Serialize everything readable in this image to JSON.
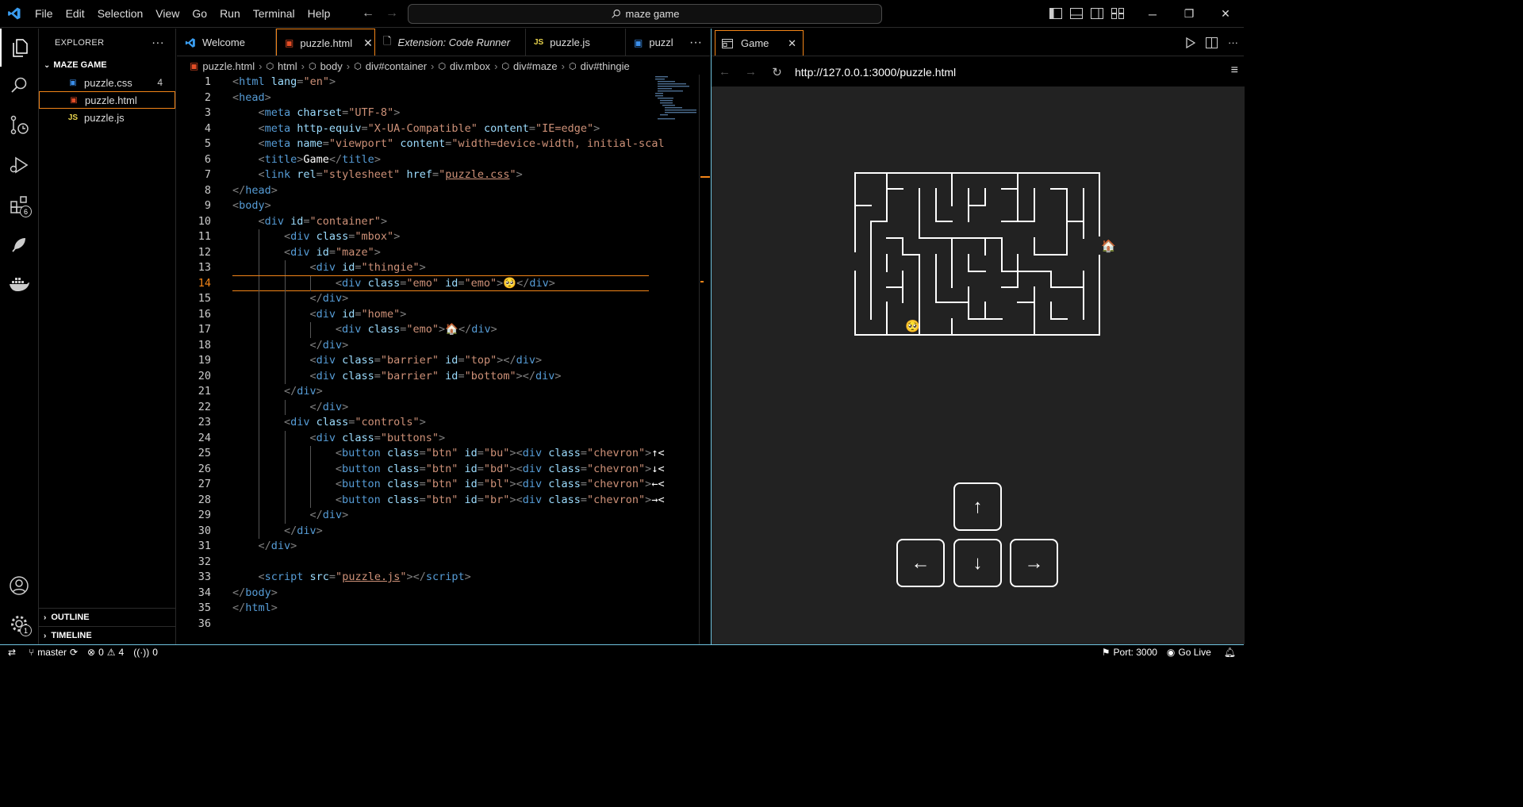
{
  "titlebar": {
    "menu": [
      "File",
      "Edit",
      "Selection",
      "View",
      "Go",
      "Run",
      "Terminal",
      "Help"
    ],
    "search": "maze game"
  },
  "sidebar": {
    "title": "EXPLORER",
    "folder": "MAZE GAME",
    "files": [
      {
        "name": "puzzle.css",
        "icon": "css-file-icon",
        "count": "4"
      },
      {
        "name": "puzzle.html",
        "icon": "html-file-icon",
        "count": ""
      },
      {
        "name": "puzzle.js",
        "icon": "js-file-icon",
        "count": ""
      }
    ],
    "outline": "OUTLINE",
    "timeline": "TIMELINE"
  },
  "activity_badges": {
    "extensions": "6",
    "settings": "1"
  },
  "tabs": [
    {
      "label": "Welcome"
    },
    {
      "label": "puzzle.html"
    },
    {
      "label": "Extension: Code Runner"
    },
    {
      "label": "puzzle.js"
    },
    {
      "label": "puzzl"
    }
  ],
  "breadcrumb": [
    "puzzle.html",
    "html",
    "body",
    "div#container",
    "div.mbox",
    "div#maze",
    "div#thingie"
  ],
  "editor_lines": [
    {
      "indent": 0,
      "tokens": [
        [
          "p",
          "<"
        ],
        [
          "t",
          "html"
        ],
        [
          "a",
          " lang"
        ],
        [
          "p",
          "="
        ],
        [
          "s",
          "\"en\""
        ],
        [
          "p",
          ">"
        ]
      ]
    },
    {
      "indent": 0,
      "tokens": [
        [
          "p",
          "<"
        ],
        [
          "t",
          "head"
        ],
        [
          "p",
          ">"
        ]
      ]
    },
    {
      "indent": 1,
      "tokens": [
        [
          "p",
          "<"
        ],
        [
          "t",
          "meta"
        ],
        [
          "a",
          " charset"
        ],
        [
          "p",
          "="
        ],
        [
          "s",
          "\"UTF-8\""
        ],
        [
          "p",
          ">"
        ]
      ]
    },
    {
      "indent": 1,
      "tokens": [
        [
          "p",
          "<"
        ],
        [
          "t",
          "meta"
        ],
        [
          "a",
          " http-equiv"
        ],
        [
          "p",
          "="
        ],
        [
          "s",
          "\"X-UA-Compatible\""
        ],
        [
          "a",
          " content"
        ],
        [
          "p",
          "="
        ],
        [
          "s",
          "\"IE=edge\""
        ],
        [
          "p",
          ">"
        ]
      ]
    },
    {
      "indent": 1,
      "tokens": [
        [
          "p",
          "<"
        ],
        [
          "t",
          "meta"
        ],
        [
          "a",
          " name"
        ],
        [
          "p",
          "="
        ],
        [
          "s",
          "\"viewport\""
        ],
        [
          "a",
          " content"
        ],
        [
          "p",
          "="
        ],
        [
          "s",
          "\"width=device-width, initial-scal"
        ]
      ]
    },
    {
      "indent": 1,
      "tokens": [
        [
          "p",
          "<"
        ],
        [
          "t",
          "title"
        ],
        [
          "p",
          ">"
        ],
        [
          "tx",
          "Game"
        ],
        [
          "p",
          "</"
        ],
        [
          "t",
          "title"
        ],
        [
          "p",
          ">"
        ]
      ]
    },
    {
      "indent": 1,
      "tokens": [
        [
          "p",
          "<"
        ],
        [
          "t",
          "link"
        ],
        [
          "a",
          " rel"
        ],
        [
          "p",
          "="
        ],
        [
          "s",
          "\"stylesheet\""
        ],
        [
          "a",
          " href"
        ],
        [
          "p",
          "="
        ],
        [
          "s",
          "\""
        ],
        [
          "su",
          "puzzle.css"
        ],
        [
          "s",
          "\""
        ],
        [
          "p",
          ">"
        ]
      ]
    },
    {
      "indent": 0,
      "tokens": [
        [
          "p",
          "</"
        ],
        [
          "t",
          "head"
        ],
        [
          "p",
          ">"
        ]
      ]
    },
    {
      "indent": 0,
      "tokens": [
        [
          "p",
          "<"
        ],
        [
          "t",
          "body"
        ],
        [
          "p",
          ">"
        ]
      ]
    },
    {
      "indent": 1,
      "tokens": [
        [
          "p",
          "<"
        ],
        [
          "t",
          "div"
        ],
        [
          "a",
          " id"
        ],
        [
          "p",
          "="
        ],
        [
          "s",
          "\"container\""
        ],
        [
          "p",
          ">"
        ]
      ]
    },
    {
      "indent": 2,
      "tokens": [
        [
          "p",
          "<"
        ],
        [
          "t",
          "div"
        ],
        [
          "a",
          " class"
        ],
        [
          "p",
          "="
        ],
        [
          "s",
          "\"mbox\""
        ],
        [
          "p",
          ">"
        ]
      ]
    },
    {
      "indent": 2,
      "tokens": [
        [
          "p",
          "<"
        ],
        [
          "t",
          "div"
        ],
        [
          "a",
          " id"
        ],
        [
          "p",
          "="
        ],
        [
          "s",
          "\"maze\""
        ],
        [
          "p",
          ">"
        ]
      ]
    },
    {
      "indent": 3,
      "tokens": [
        [
          "p",
          "<"
        ],
        [
          "t",
          "div"
        ],
        [
          "a",
          " id"
        ],
        [
          "p",
          "="
        ],
        [
          "s",
          "\"thingie\""
        ],
        [
          "p",
          ">"
        ]
      ]
    },
    {
      "indent": 4,
      "tokens": [
        [
          "p",
          "<"
        ],
        [
          "t",
          "div"
        ],
        [
          "a",
          " class"
        ],
        [
          "p",
          "="
        ],
        [
          "s",
          "\"emo\""
        ],
        [
          "a",
          " id"
        ],
        [
          "p",
          "="
        ],
        [
          "s",
          "\"emo\""
        ],
        [
          "p",
          ">"
        ],
        [
          "tx",
          "🥺"
        ],
        [
          "p",
          "</"
        ],
        [
          "t",
          "div"
        ],
        [
          "p",
          ">"
        ]
      ]
    },
    {
      "indent": 3,
      "tokens": [
        [
          "p",
          "</"
        ],
        [
          "t",
          "div"
        ],
        [
          "p",
          ">"
        ]
      ]
    },
    {
      "indent": 3,
      "tokens": [
        [
          "p",
          "<"
        ],
        [
          "t",
          "div"
        ],
        [
          "a",
          " id"
        ],
        [
          "p",
          "="
        ],
        [
          "s",
          "\"home\""
        ],
        [
          "p",
          ">"
        ]
      ]
    },
    {
      "indent": 4,
      "tokens": [
        [
          "p",
          "<"
        ],
        [
          "t",
          "div"
        ],
        [
          "a",
          " class"
        ],
        [
          "p",
          "="
        ],
        [
          "s",
          "\"emo\""
        ],
        [
          "p",
          ">"
        ],
        [
          "tx",
          "🏠"
        ],
        [
          "p",
          "</"
        ],
        [
          "t",
          "div"
        ],
        [
          "p",
          ">"
        ]
      ]
    },
    {
      "indent": 3,
      "tokens": [
        [
          "p",
          "</"
        ],
        [
          "t",
          "div"
        ],
        [
          "p",
          ">"
        ]
      ]
    },
    {
      "indent": 3,
      "tokens": [
        [
          "p",
          "<"
        ],
        [
          "t",
          "div"
        ],
        [
          "a",
          " class"
        ],
        [
          "p",
          "="
        ],
        [
          "s",
          "\"barrier\""
        ],
        [
          "a",
          " id"
        ],
        [
          "p",
          "="
        ],
        [
          "s",
          "\"top\""
        ],
        [
          "p",
          "></"
        ],
        [
          "t",
          "div"
        ],
        [
          "p",
          ">"
        ]
      ]
    },
    {
      "indent": 3,
      "tokens": [
        [
          "p",
          "<"
        ],
        [
          "t",
          "div"
        ],
        [
          "a",
          " class"
        ],
        [
          "p",
          "="
        ],
        [
          "s",
          "\"barrier\""
        ],
        [
          "a",
          " id"
        ],
        [
          "p",
          "="
        ],
        [
          "s",
          "\"bottom\""
        ],
        [
          "p",
          "></"
        ],
        [
          "t",
          "div"
        ],
        [
          "p",
          ">"
        ]
      ]
    },
    {
      "indent": 2,
      "tokens": [
        [
          "p",
          "</"
        ],
        [
          "t",
          "div"
        ],
        [
          "p",
          ">"
        ]
      ]
    },
    {
      "indent": 3,
      "tokens": [
        [
          "p",
          "</"
        ],
        [
          "t",
          "div"
        ],
        [
          "p",
          ">"
        ]
      ]
    },
    {
      "indent": 2,
      "tokens": [
        [
          "p",
          "<"
        ],
        [
          "t",
          "div"
        ],
        [
          "a",
          " class"
        ],
        [
          "p",
          "="
        ],
        [
          "s",
          "\"controls\""
        ],
        [
          "p",
          ">"
        ]
      ]
    },
    {
      "indent": 3,
      "tokens": [
        [
          "p",
          "<"
        ],
        [
          "t",
          "div"
        ],
        [
          "a",
          " class"
        ],
        [
          "p",
          "="
        ],
        [
          "s",
          "\"buttons\""
        ],
        [
          "p",
          ">"
        ]
      ]
    },
    {
      "indent": 4,
      "tokens": [
        [
          "p",
          "<"
        ],
        [
          "t",
          "button"
        ],
        [
          "a",
          " class"
        ],
        [
          "p",
          "="
        ],
        [
          "s",
          "\"btn\""
        ],
        [
          "a",
          " id"
        ],
        [
          "p",
          "="
        ],
        [
          "s",
          "\"bu\""
        ],
        [
          "p",
          "><"
        ],
        [
          "t",
          "div"
        ],
        [
          "a",
          " class"
        ],
        [
          "p",
          "="
        ],
        [
          "s",
          "\"chevron\""
        ],
        [
          "p",
          ">"
        ],
        [
          "tx",
          "↑<"
        ]
      ]
    },
    {
      "indent": 4,
      "tokens": [
        [
          "p",
          "<"
        ],
        [
          "t",
          "button"
        ],
        [
          "a",
          " class"
        ],
        [
          "p",
          "="
        ],
        [
          "s",
          "\"btn\""
        ],
        [
          "a",
          " id"
        ],
        [
          "p",
          "="
        ],
        [
          "s",
          "\"bd\""
        ],
        [
          "p",
          "><"
        ],
        [
          "t",
          "div"
        ],
        [
          "a",
          " class"
        ],
        [
          "p",
          "="
        ],
        [
          "s",
          "\"chevron\""
        ],
        [
          "p",
          ">"
        ],
        [
          "tx",
          "↓<"
        ]
      ]
    },
    {
      "indent": 4,
      "tokens": [
        [
          "p",
          "<"
        ],
        [
          "t",
          "button"
        ],
        [
          "a",
          " class"
        ],
        [
          "p",
          "="
        ],
        [
          "s",
          "\"btn\""
        ],
        [
          "a",
          " id"
        ],
        [
          "p",
          "="
        ],
        [
          "s",
          "\"bl\""
        ],
        [
          "p",
          "><"
        ],
        [
          "t",
          "div"
        ],
        [
          "a",
          " class"
        ],
        [
          "p",
          "="
        ],
        [
          "s",
          "\"chevron\""
        ],
        [
          "p",
          ">"
        ],
        [
          "tx",
          "←<"
        ]
      ]
    },
    {
      "indent": 4,
      "tokens": [
        [
          "p",
          "<"
        ],
        [
          "t",
          "button"
        ],
        [
          "a",
          " class"
        ],
        [
          "p",
          "="
        ],
        [
          "s",
          "\"btn\""
        ],
        [
          "a",
          " id"
        ],
        [
          "p",
          "="
        ],
        [
          "s",
          "\"br\""
        ],
        [
          "p",
          "><"
        ],
        [
          "t",
          "div"
        ],
        [
          "a",
          " class"
        ],
        [
          "p",
          "="
        ],
        [
          "s",
          "\"chevron\""
        ],
        [
          "p",
          ">"
        ],
        [
          "tx",
          "→<"
        ]
      ]
    },
    {
      "indent": 3,
      "tokens": [
        [
          "p",
          "</"
        ],
        [
          "t",
          "div"
        ],
        [
          "p",
          ">"
        ]
      ]
    },
    {
      "indent": 2,
      "tokens": [
        [
          "p",
          "</"
        ],
        [
          "t",
          "div"
        ],
        [
          "p",
          ">"
        ]
      ]
    },
    {
      "indent": 1,
      "tokens": [
        [
          "p",
          "</"
        ],
        [
          "t",
          "div"
        ],
        [
          "p",
          ">"
        ]
      ]
    },
    {
      "indent": 0,
      "tokens": []
    },
    {
      "indent": 1,
      "tokens": [
        [
          "p",
          "<"
        ],
        [
          "t",
          "script"
        ],
        [
          "a",
          " src"
        ],
        [
          "p",
          "="
        ],
        [
          "s",
          "\""
        ],
        [
          "su",
          "puzzle.js"
        ],
        [
          "s",
          "\""
        ],
        [
          "p",
          "></"
        ],
        [
          "t",
          "script"
        ],
        [
          "p",
          ">"
        ]
      ]
    },
    {
      "indent": 0,
      "tokens": [
        [
          "p",
          "</"
        ],
        [
          "t",
          "body"
        ],
        [
          "p",
          ">"
        ]
      ]
    },
    {
      "indent": 0,
      "tokens": [
        [
          "p",
          "</"
        ],
        [
          "t",
          "html"
        ],
        [
          "p",
          ">"
        ]
      ]
    },
    {
      "indent": 0,
      "tokens": []
    }
  ],
  "current_line": 14,
  "browser": {
    "tab": "Game",
    "url": "http://127.0.0.1:3000/puzzle.html",
    "player_emoji": "🥺",
    "home_emoji": "🏠",
    "controls": {
      "up": "↑",
      "left": "←",
      "down": "↓",
      "right": "→"
    }
  },
  "statusbar": {
    "branch": "master",
    "errors": "0",
    "warnings": "4",
    "ports": "0",
    "port": "Port: 3000",
    "golive": "Go Live"
  },
  "colors": {
    "accent": "#f38518",
    "focus": "#6fc3df",
    "tag": "#569cd6",
    "attr": "#9cdcfe",
    "string": "#ce9178"
  }
}
